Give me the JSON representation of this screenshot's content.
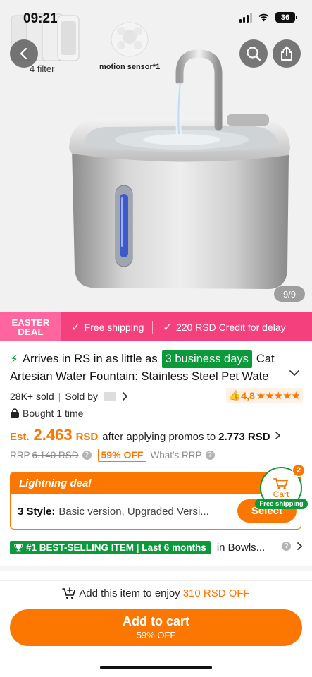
{
  "status_bar": {
    "time": "09:21",
    "battery": "36"
  },
  "hero": {
    "thumb_filter_caption": "4 filter",
    "thumb_sensor_caption": "motion sensor*1",
    "image_counter": "9/9"
  },
  "promo_strip": {
    "event_line1": "EASTER",
    "event_line2": "DEAL",
    "item1": "Free shipping",
    "item2": "220 RSD Credit for delay"
  },
  "product": {
    "arrives_prefix": "Arrives in RS in as little as",
    "arrives_highlight": "3 business days",
    "title_start": "Cat",
    "title_line2": "Artesian Water Fountain: Stainless Steel Pet Wate",
    "sold": "28K+ sold",
    "sold_by": "Sold by",
    "rating": "4,8",
    "stars": "★★★★★",
    "bought": "Bought 1 time"
  },
  "price": {
    "est_label": "Est.",
    "amount": "2.463",
    "currency": "RSD",
    "after_text": "after applying promos to",
    "final": "2.773 RSD",
    "rrp_label": "RRP",
    "rrp_value": "6.140 RSD",
    "discount": "59% OFF",
    "whats_rrp": "What's RRP"
  },
  "deal": {
    "title": "Lightning deal",
    "style_label": "3 Style:",
    "style_options": "Basic version, Upgraded Versi...",
    "select_label": "Select"
  },
  "cart_float": {
    "label": "Cart",
    "count": "2",
    "free_shipping": "Free shipping"
  },
  "best_selling": {
    "badge": "#1 BEST-SELLING ITEM | Last 6 months",
    "category": "in Bowls..."
  },
  "bottom": {
    "promo_prefix": "Add this item to enjoy",
    "promo_amount": "310 RSD OFF",
    "add_to_cart": "Add to cart",
    "add_to_cart_sub": "59% OFF"
  },
  "colors": {
    "accent": "#fb7701",
    "green": "#0a9a3a",
    "promo_pink": "#f5407e"
  },
  "icons": [
    "back-arrow-icon",
    "search-icon",
    "share-icon",
    "lightning-icon",
    "check-icon",
    "lock-bag-icon",
    "help-icon",
    "cart-icon",
    "trophy-icon",
    "cart-plus-icon",
    "chevron-right-icon",
    "chevron-down-icon"
  ]
}
